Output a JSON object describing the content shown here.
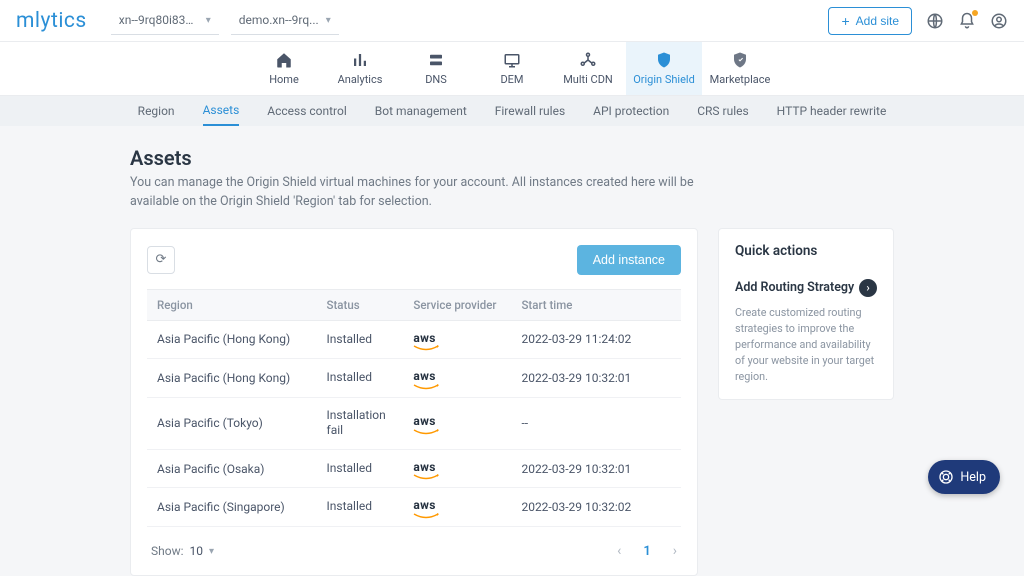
{
  "brand": "mlytics",
  "top": {
    "dropdown1": "xn--9rq80i83o...",
    "dropdown2": "demo.xn--9rq...",
    "add_site_label": "Add site"
  },
  "nav": [
    {
      "label": "Home",
      "icon": "home-icon"
    },
    {
      "label": "Analytics",
      "icon": "analytics-icon"
    },
    {
      "label": "DNS",
      "icon": "dns-icon"
    },
    {
      "label": "DEM",
      "icon": "dem-icon"
    },
    {
      "label": "Multi CDN",
      "icon": "multicdn-icon"
    },
    {
      "label": "Origin Shield",
      "icon": "shield-icon",
      "active": true
    },
    {
      "label": "Marketplace",
      "icon": "marketplace-icon"
    }
  ],
  "subnav": [
    {
      "label": "Region"
    },
    {
      "label": "Assets",
      "active": true
    },
    {
      "label": "Access control"
    },
    {
      "label": "Bot management"
    },
    {
      "label": "Firewall rules"
    },
    {
      "label": "API protection"
    },
    {
      "label": "CRS rules"
    },
    {
      "label": "HTTP header rewrite"
    }
  ],
  "page": {
    "title": "Assets",
    "description": "You can manage the Origin Shield virtual machines for your account. All instances created here will be available on the Origin Shield 'Region' tab for selection.",
    "add_instance_label": "Add instance"
  },
  "table": {
    "headers": {
      "region": "Region",
      "status": "Status",
      "sp": "Service provider",
      "start": "Start time"
    },
    "rows": [
      {
        "region": "Asia Pacific (Hong Kong)",
        "status": "Installed",
        "sp": "aws",
        "start": "2022-03-29 11:24:02"
      },
      {
        "region": "Asia Pacific (Hong Kong)",
        "status": "Installed",
        "sp": "aws",
        "start": "2022-03-29 10:32:01"
      },
      {
        "region": "Asia Pacific (Tokyo)",
        "status": "Installation fail",
        "sp": "aws",
        "start": "--"
      },
      {
        "region": "Asia Pacific (Osaka)",
        "status": "Installed",
        "sp": "aws",
        "start": "2022-03-29 10:32:01"
      },
      {
        "region": "Asia Pacific (Singapore)",
        "status": "Installed",
        "sp": "aws",
        "start": "2022-03-29 10:32:02"
      }
    ],
    "show_label": "Show:",
    "show_value": "10",
    "page_num": "1"
  },
  "quick_actions": {
    "title": "Quick actions",
    "item_title": "Add Routing Strategy",
    "item_desc": "Create customized routing strategies to improve the performance and availability of your website in your target region."
  },
  "help": {
    "label": "Help"
  }
}
